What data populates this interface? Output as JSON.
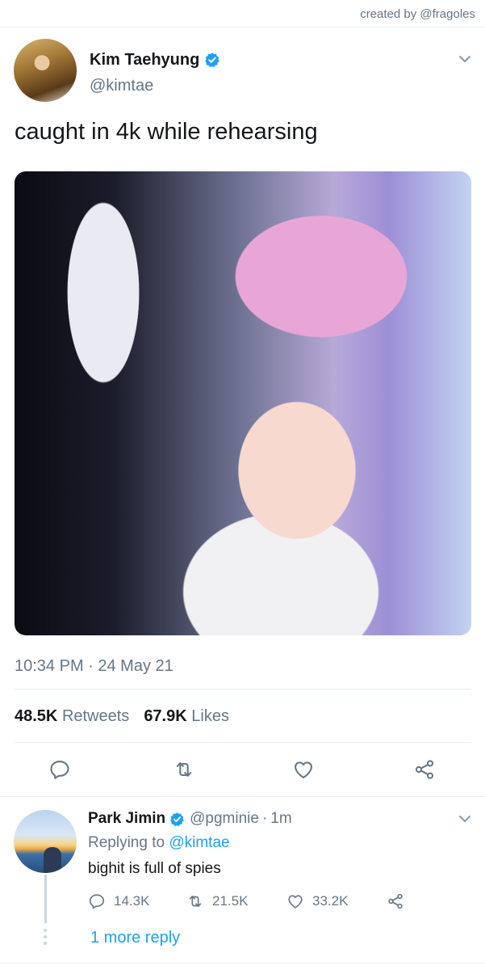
{
  "credit": "created by @fragoles",
  "tweet": {
    "display_name": "Kim Taehyung",
    "handle": "@kimtae",
    "text": "caught in 4k while rehearsing",
    "timestamp": "10:34 PM · 24 May 21",
    "stats": {
      "retweets_count": "48.5K",
      "retweets_label": "Retweets",
      "likes_count": "67.9K",
      "likes_label": "Likes"
    },
    "actions": [
      "reply-icon",
      "retweet-icon",
      "like-icon",
      "share-icon"
    ]
  },
  "reply": {
    "display_name": "Park Jimin",
    "handle": "@pgminie",
    "separator": "·",
    "time": "1m",
    "replying_prefix": "Replying to",
    "replying_to": "@kimtae",
    "text": "bighit is full of spies",
    "reply_count": "14.3K",
    "retweet_count": "21.5K",
    "like_count": "33.2K",
    "more_replies": "1 more reply"
  },
  "colors": {
    "accent": "#1da1f2",
    "secondary_text": "#657786",
    "divider": "#e6ecf0"
  }
}
